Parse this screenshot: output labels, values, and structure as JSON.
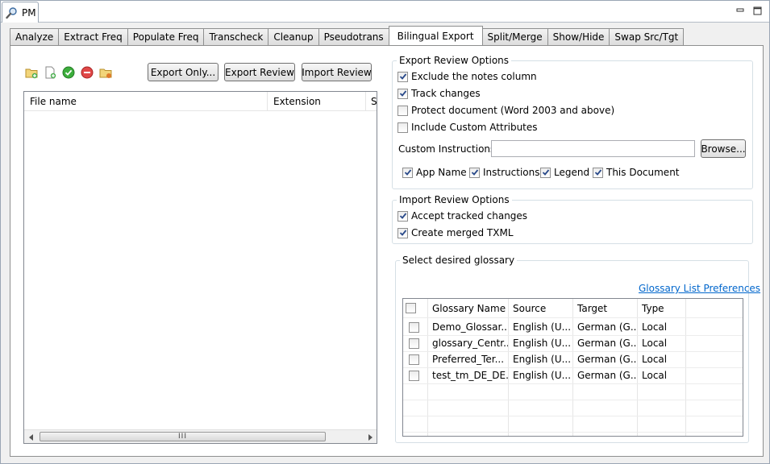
{
  "window": {
    "view_tab_label": "PM"
  },
  "tabs": [
    {
      "label": "Analyze"
    },
    {
      "label": "Extract Freq"
    },
    {
      "label": "Populate Freq"
    },
    {
      "label": "Transcheck"
    },
    {
      "label": "Cleanup"
    },
    {
      "label": "Pseudotrans"
    },
    {
      "label": "Bilingual Export",
      "active": true
    },
    {
      "label": "Split/Merge"
    },
    {
      "label": "Show/Hide"
    },
    {
      "label": "Swap Src/Tgt"
    }
  ],
  "toolbar": {
    "icons": [
      "add-folder-icon",
      "add-file-icon",
      "check-icon",
      "remove-icon",
      "folder-settings-icon"
    ],
    "export_only_label": "Export Only...",
    "export_review_label": "Export Review",
    "import_review_label": "Import Review"
  },
  "file_table": {
    "columns": [
      "File name",
      "Extension",
      "S"
    ],
    "scroll_thumb_label": "III"
  },
  "export_options": {
    "title": "Export Review Options",
    "items": [
      {
        "label": "Exclude the notes column",
        "checked": true
      },
      {
        "label": "Track changes",
        "checked": true
      },
      {
        "label": "Protect document (Word 2003 and above)",
        "checked": false
      },
      {
        "label": "Include Custom Attributes",
        "checked": false
      }
    ],
    "custom_instructions_label": "Custom Instructions:",
    "custom_instructions_value": "",
    "browse_label": "Browse...",
    "inline_items": [
      {
        "label": "App Name",
        "checked": true
      },
      {
        "label": "Instructions",
        "checked": true
      },
      {
        "label": "Legend",
        "checked": true
      },
      {
        "label": "This Document",
        "checked": true
      }
    ]
  },
  "import_options": {
    "title": "Import Review Options",
    "items": [
      {
        "label": "Accept tracked changes",
        "checked": true
      },
      {
        "label": "Create merged TXML",
        "checked": true
      }
    ]
  },
  "glossary": {
    "title": "Select desired glossary",
    "preferences_link": "Glossary List Preferences",
    "columns": [
      "Glossary Name",
      "Source",
      "Target",
      "Type"
    ],
    "rows": [
      {
        "name": "Demo_Glossar...",
        "source": "English (U...",
        "target": "German (G...",
        "type": "Local",
        "checked": false
      },
      {
        "name": "glossary_Centr...",
        "source": "English (U...",
        "target": "German (G...",
        "type": "Local",
        "checked": false
      },
      {
        "name": "Preferred_Ter...",
        "source": "English (U...",
        "target": "German (G...",
        "type": "Local",
        "checked": false
      },
      {
        "name": "test_tm_DE_DE...",
        "source": "English (U...",
        "target": "German (G...",
        "type": "Local",
        "checked": false
      }
    ]
  },
  "colors": {
    "link": "#0066cc",
    "border": "#828790",
    "check": "#2a4a8a"
  }
}
